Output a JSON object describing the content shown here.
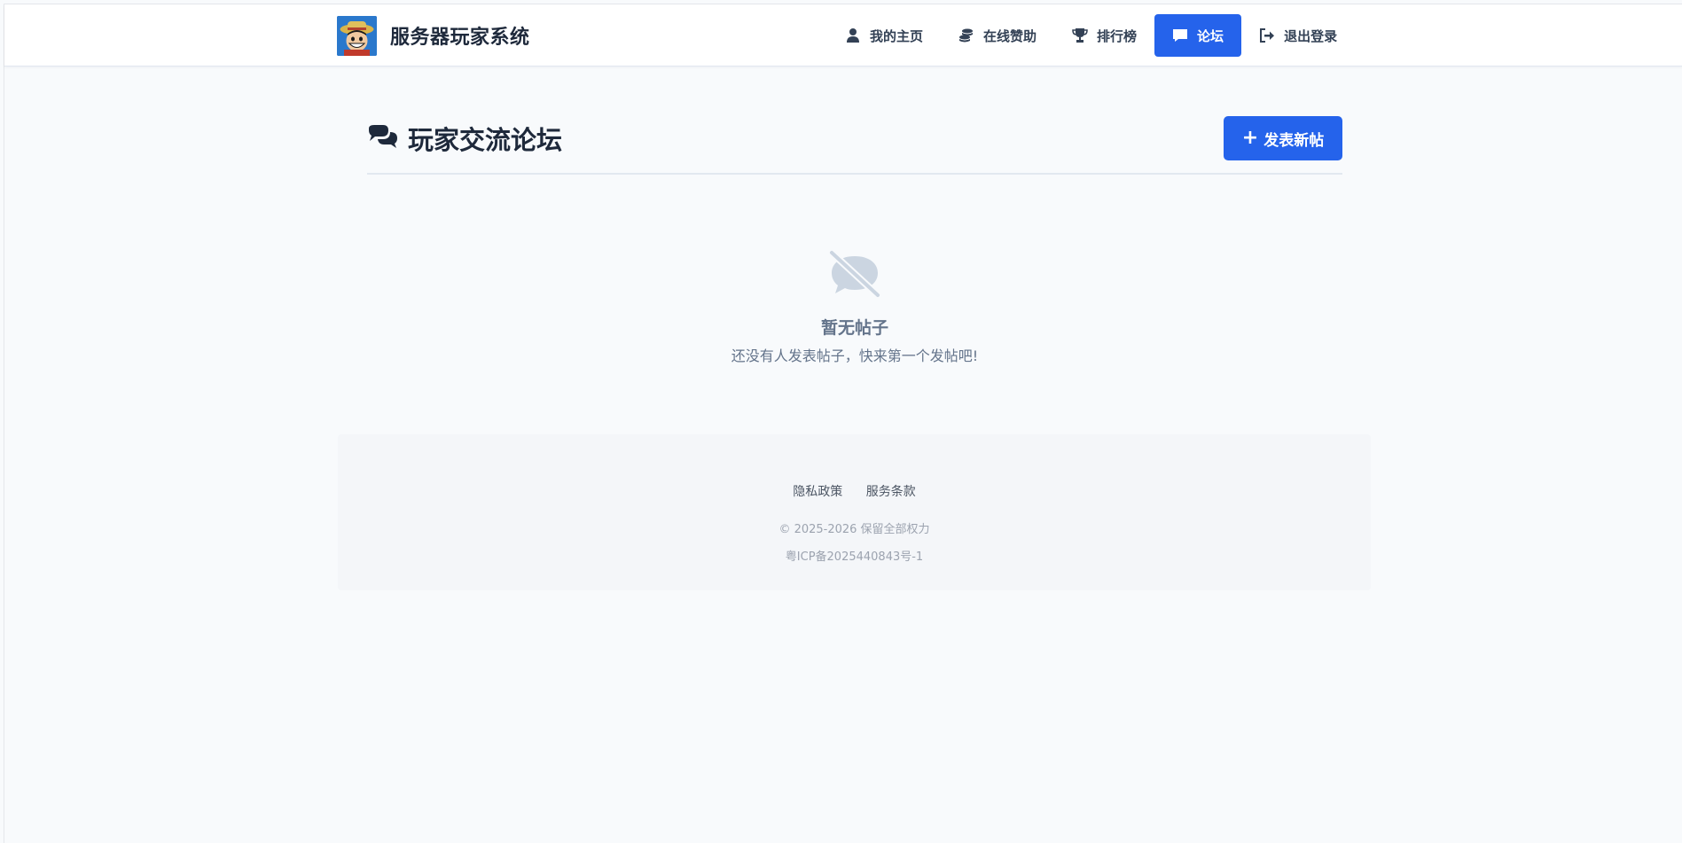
{
  "header": {
    "brand_title": "服务器玩家系统",
    "nav": [
      {
        "label": "我的主页",
        "icon": "user-icon",
        "active": false
      },
      {
        "label": "在线赞助",
        "icon": "coins-icon",
        "active": false
      },
      {
        "label": "排行榜",
        "icon": "trophy-icon",
        "active": false
      },
      {
        "label": "论坛",
        "icon": "comment-icon",
        "active": true
      },
      {
        "label": "退出登录",
        "icon": "sign-out-icon",
        "active": false
      }
    ]
  },
  "main": {
    "title": "玩家交流论坛",
    "title_icon": "comments-icon",
    "new_post_label": "发表新帖",
    "empty": {
      "icon": "comment-slash-icon",
      "title": "暂无帖子",
      "subtitle": "还没有人发表帖子，快来第一个发帖吧!"
    }
  },
  "footer": {
    "links": [
      "隐私政策",
      "服务条款"
    ],
    "copyright": "© 2025-2026 保留全部权力",
    "icp": "粤ICP备2025440843号-1"
  },
  "colors": {
    "accent": "#2563eb",
    "text_dark": "#1e293b",
    "muted": "#64748b",
    "page_bg": "#f8fafc"
  }
}
